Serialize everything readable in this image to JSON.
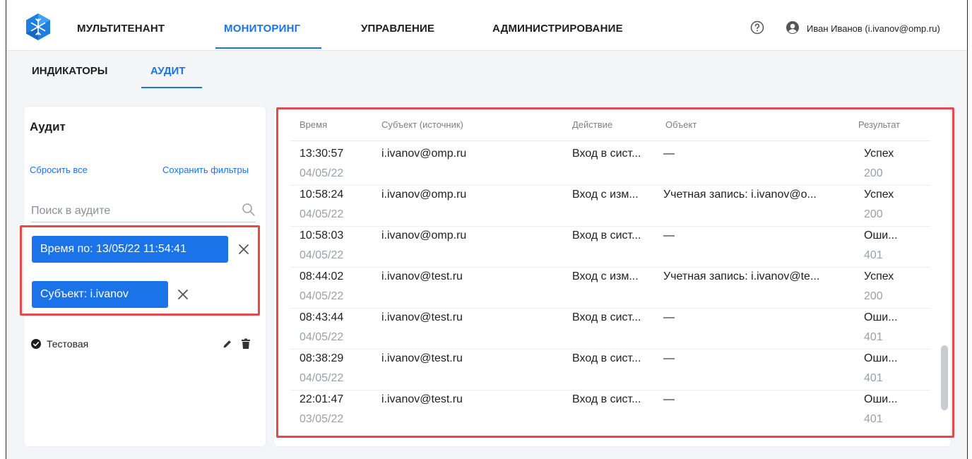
{
  "topnav": {
    "items": [
      {
        "label": "МУЛЬТИТЕНАНТ"
      },
      {
        "label": "МОНИТОРИНГ"
      },
      {
        "label": "УПРАВЛЕНИЕ"
      },
      {
        "label": "АДМИНИСТРИРОВАНИЕ"
      }
    ],
    "active_index": 1,
    "user": "Иван Иванов (i.ivanov@omp.ru)",
    "help_icon": "help-circle-icon",
    "user_icon": "account-circle-icon",
    "logo_icon": "snowflake-hexagon-logo"
  },
  "subtabs": {
    "items": [
      {
        "label": "ИНДИКАТОРЫ"
      },
      {
        "label": "АУДИТ"
      }
    ],
    "active_index": 1
  },
  "sidebar": {
    "title": "Аудит",
    "reset_label": "Сбросить все",
    "save_label": "Сохранить фильтры",
    "search_placeholder": "Поиск в аудите",
    "chips": [
      {
        "label": "Время по: 13/05/22 11:54:41"
      },
      {
        "label": "Субъект: i.ivanov"
      }
    ],
    "saved_filters": [
      {
        "label": "Тестовая"
      }
    ]
  },
  "table": {
    "columns": [
      "Время",
      "Субъект (источник)",
      "Действие",
      "Объект",
      "Результат"
    ],
    "rows": [
      {
        "time": "13:30:57",
        "date": "04/05/22",
        "subject": "i.ivanov@omp.ru",
        "action": "Вход в сист...",
        "object": "—",
        "result": "Успех",
        "code": "200"
      },
      {
        "time": "10:58:24",
        "date": "04/05/22",
        "subject": "i.ivanov@omp.ru",
        "action": "Вход с изм...",
        "object": "Учетная запись: i.ivanov@o...",
        "result": "Успех",
        "code": "200"
      },
      {
        "time": "10:58:03",
        "date": "04/05/22",
        "subject": "i.ivanov@omp.ru",
        "action": "Вход в сист...",
        "object": "—",
        "result": "Оши...",
        "code": "401"
      },
      {
        "time": "08:44:02",
        "date": "04/05/22",
        "subject": "i.ivanov@test.ru",
        "action": "Вход с изм...",
        "object": "Учетная запись: i.ivanov@te...",
        "result": "Успех",
        "code": "200"
      },
      {
        "time": "08:43:44",
        "date": "04/05/22",
        "subject": "i.ivanov@test.ru",
        "action": "Вход в сист...",
        "object": "—",
        "result": "Оши...",
        "code": "401"
      },
      {
        "time": "08:38:29",
        "date": "04/05/22",
        "subject": "i.ivanov@test.ru",
        "action": "Вход в сист...",
        "object": "—",
        "result": "Оши...",
        "code": "401"
      },
      {
        "time": "22:01:47",
        "date": "03/05/22",
        "subject": "i.ivanov@test.ru",
        "action": "Вход в сист...",
        "object": "—",
        "result": "Оши...",
        "code": "401"
      }
    ]
  },
  "colors": {
    "accent": "#1a73e8",
    "highlight": "#e5484d",
    "muted_text": "#9aa0a6"
  }
}
